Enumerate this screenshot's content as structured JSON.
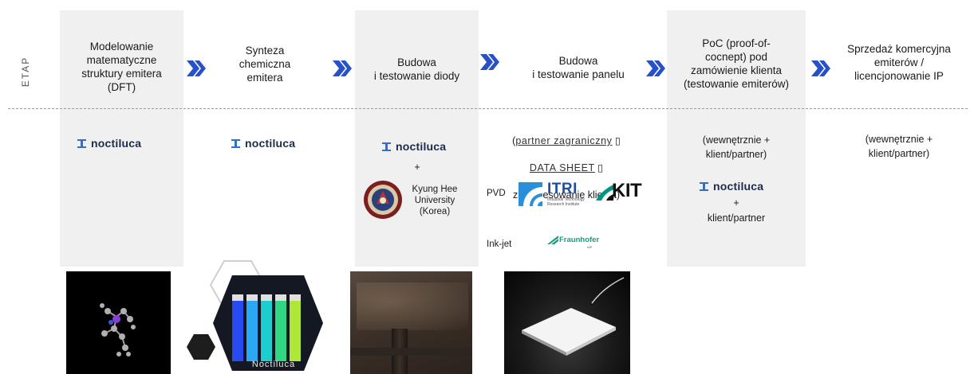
{
  "etap_label": "ETAP",
  "stages": [
    {
      "title": "Modelowanie\nmatematyczne\nstruktury emitera\n(DFT)"
    },
    {
      "title": "Synteza\nchemiczna\nemitera"
    },
    {
      "title": "Budowa\ni testowanie diody"
    },
    {
      "title": "Budowa\ni testowanie panelu"
    },
    {
      "title": "PoC (proof-of-\ncocnept) pod\nzamówienie klienta\n(testowanie emiterów)"
    },
    {
      "title": "Sprzedaż komercyjna\nemiterów /\nlicencjonowanie IP"
    }
  ],
  "logo_name": "noctiluca",
  "plus": "+",
  "diode": {
    "partner": "Kyung Hee\nUniversity\n(Korea)"
  },
  "panel": {
    "line1_prefix": "(",
    "line1_link": "partner zagraniczny",
    "line1_suffix": " ▯",
    "line2_link": "DATA SHEET",
    "line2_suffix": " ▯",
    "line3": "zainteresowanie klienta)",
    "pvd_label": "PVD",
    "inkjet_label": "Ink-jet",
    "itri_name": "ITRI",
    "itri_sub": "Industrial Technology\nResearch Institute",
    "kit_name": "KIT",
    "fraunhofer_name": "Fraunhofer",
    "fraunhofer_sub": "IAP"
  },
  "poc": {
    "text1": "(wewnętrznie +\nklient/partner)",
    "text2": "klient/partner"
  },
  "sales": {
    "text1": "(wewnętrznie +\nklient/partner)"
  },
  "vials_logo": "Noctiluca",
  "colors": {
    "logo_navy": "#1e2b48",
    "logo_blue": "#2f6fd1",
    "chevron": "#2850c8",
    "column_bg": "#f0f0f0"
  }
}
